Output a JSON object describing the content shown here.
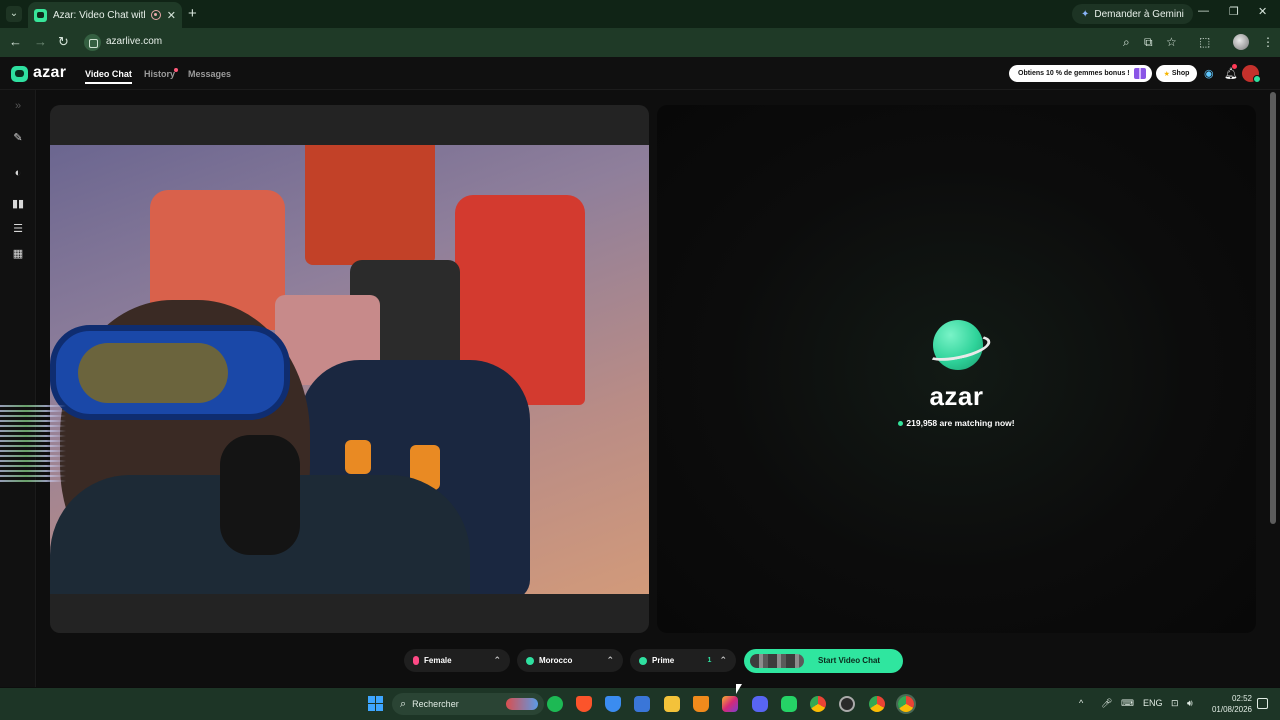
{
  "browser": {
    "tab_title": "Azar: Video Chat with New",
    "new_tab_symbol": "+",
    "close_symbol": "✕",
    "gemini_label": "Demander à Gemini",
    "url": "azarlive.com",
    "window_controls": [
      "—",
      "❐",
      "✕"
    ]
  },
  "app": {
    "logo": "azar",
    "nav": {
      "video_chat": "Video Chat",
      "history": "History",
      "messages": "Messages"
    },
    "promo": "Obtiens 10 % de gemmes bonus !",
    "shop": "Shop"
  },
  "match_panel": {
    "brand": "azar",
    "matching_text": "219,958 are matching now!"
  },
  "controls": {
    "gender": "Female",
    "country": "Morocco",
    "prime": "Prime",
    "prime_count": "1",
    "start": "Start Video Chat"
  },
  "taskbar": {
    "search_placeholder": "Rechercher",
    "lang": "ENG",
    "time": "02:52",
    "date": "01/08/2026",
    "chevron": "^"
  },
  "colors": {
    "accent": "#2fe69f",
    "browser_bg": "#1f3a27",
    "app_bg": "#0e0e0e"
  },
  "icons": [
    "back-icon",
    "forward-icon",
    "reload-icon",
    "site-info-icon",
    "zoom-icon",
    "install-icon",
    "bookmark-star-icon",
    "extensions-icon",
    "menu-icon",
    "gift-icon",
    "chat-bubble-icon",
    "bell-icon",
    "magic-wand-icon",
    "filter-icon",
    "layout-side-icon",
    "layout-stack-icon",
    "layout-grid-icon",
    "collapse-icon"
  ]
}
